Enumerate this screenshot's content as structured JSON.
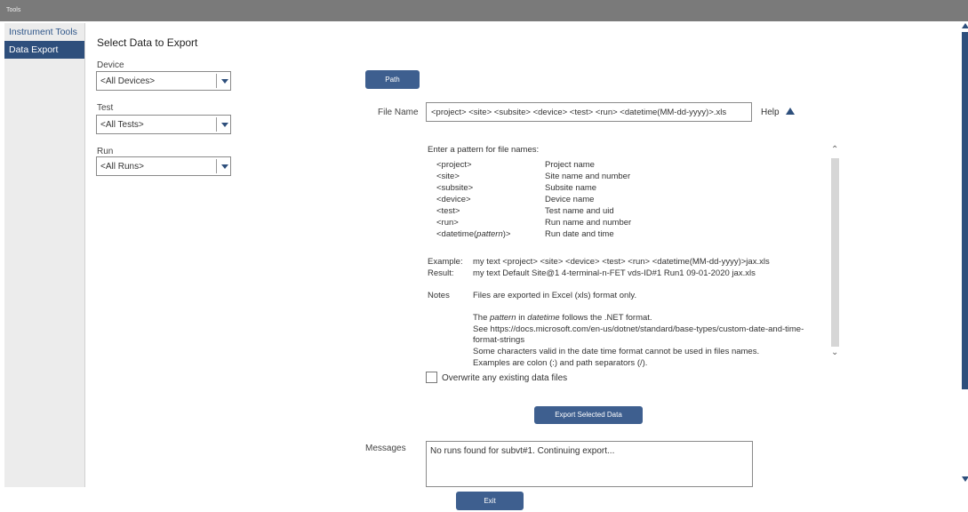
{
  "window": {
    "title": "Tools"
  },
  "sidebar": {
    "items": [
      {
        "label": "Instrument Tools"
      },
      {
        "label": "Data Export"
      }
    ]
  },
  "main": {
    "title": "Select Data to Export",
    "device": {
      "label": "Device",
      "value": "<All Devices>"
    },
    "test": {
      "label": "Test",
      "value": "<All Tests>"
    },
    "run": {
      "label": "Run",
      "value": "<All Runs>"
    },
    "path_button": "Path",
    "file_name_label": "File Name",
    "file_name_value": "<project> <site> <subsite> <device> <test> <run> <datetime(MM-dd-yyyy)>.xls",
    "help_label": "Help",
    "help": {
      "intro": "Enter a pattern for file names:",
      "patterns": [
        {
          "token": "<project>",
          "desc": "Project name"
        },
        {
          "token": "<site>",
          "desc": "Site name and number"
        },
        {
          "token": "<subsite>",
          "desc": "Subsite name"
        },
        {
          "token": "<device>",
          "desc": "Device name"
        },
        {
          "token": "<test>",
          "desc": "Test name and uid"
        },
        {
          "token": "<run>",
          "desc": "Run name and number"
        }
      ],
      "datetime_token_pre": "<datetime(",
      "datetime_token_italic": "pattern",
      "datetime_token_post": ")>",
      "datetime_desc": "Run date and time",
      "example_label": "Example:",
      "example_value": "my text <project> <site> <device> <test> <run> <datetime(MM-dd-yyyy)>jax.xls",
      "result_label": "Result:",
      "result_value": "my text Default Site@1 4-terminal-n-FET vds-ID#1 Run1 09-01-2020 jax.xls",
      "notes_label": "Notes",
      "note1": "Files are exported in Excel (xls) format only.",
      "note2_a": "The ",
      "note2_b": "pattern",
      "note2_c": " in ",
      "note2_d": "datetime",
      "note2_e": " follows the .NET format.",
      "note3": "See https://docs.microsoft.com/en-us/dotnet/standard/base-types/custom-date-and-time-",
      "note4": "format-strings",
      "note5": "Some characters valid in the date time format cannot be used in files names.",
      "note6": "Examples are colon (:) and path separators (/)."
    },
    "overwrite_label": "Overwrite any existing data files",
    "overwrite_checked": false,
    "export_button": "Export Selected Data",
    "messages_label": "Messages",
    "messages_value": "No runs found for subvt#1. Continuing export...",
    "exit_button": "Exit"
  },
  "colors": {
    "accent": "#2e4f7c",
    "button": "#3e5f8f",
    "titlebar": "#7a7a7a",
    "sidebar_bg": "#ececec"
  }
}
